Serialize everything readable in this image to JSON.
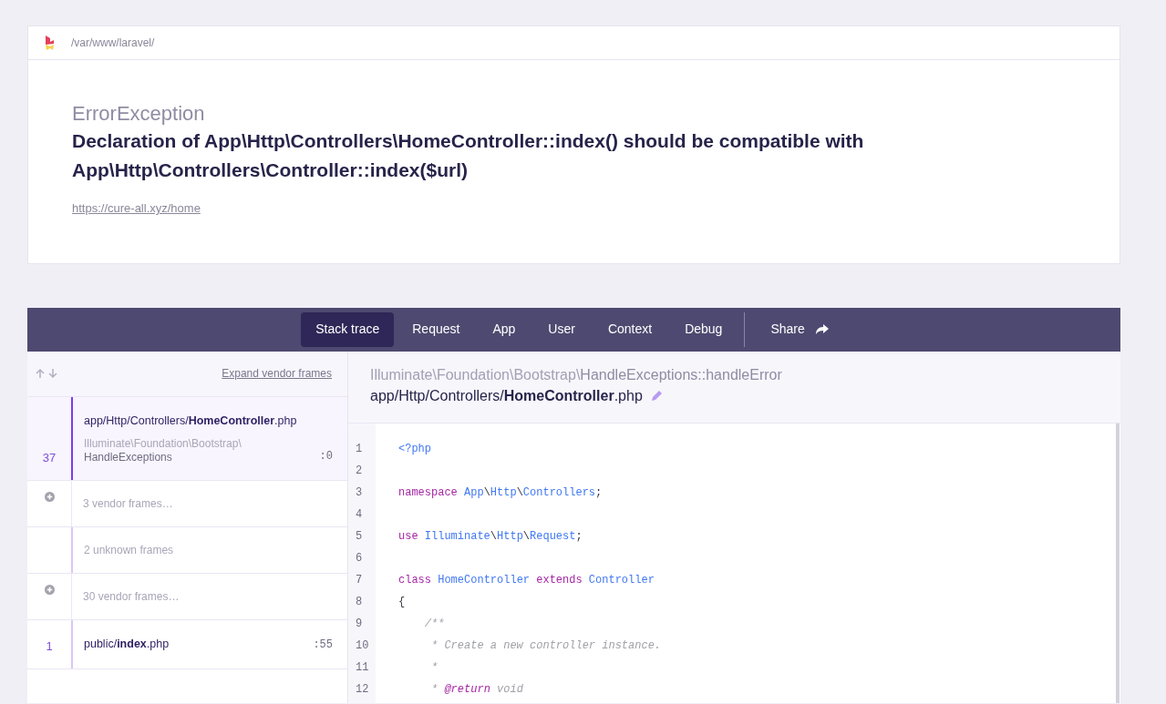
{
  "top": {
    "path": "/var/www/laravel/",
    "exception_class": "ErrorException",
    "message": "Declaration of App\\Http\\Controllers\\HomeController::index() should be compatible with App\\Http\\Controllers\\Controller::index($url)",
    "url": "https://cure-all.xyz/home"
  },
  "tabs": [
    {
      "label": "Stack trace",
      "selected": true
    },
    {
      "label": "Request",
      "selected": false
    },
    {
      "label": "App",
      "selected": false
    },
    {
      "label": "User",
      "selected": false
    },
    {
      "label": "Context",
      "selected": false
    },
    {
      "label": "Debug",
      "selected": false
    }
  ],
  "share": {
    "label": "Share"
  },
  "frames_header": {
    "expand_link": "Expand vendor frames"
  },
  "frames": [
    {
      "kind": "app",
      "selected": true,
      "number": "37",
      "file": "app/Http/Controllers/**HomeController**.php",
      "class_namespace": "Illuminate\\Foundation\\Bootstrap\\",
      "class_name": "HandleExceptions",
      "line": ":0"
    },
    {
      "kind": "vendor",
      "selected": false,
      "label": "3 vendor frames…"
    },
    {
      "kind": "unknown",
      "selected": false,
      "label": "2 unknown frames"
    },
    {
      "kind": "vendor",
      "selected": false,
      "label": "30 vendor frames…"
    },
    {
      "kind": "app",
      "selected": false,
      "number": "1",
      "file": "public/**index**.php",
      "line": ":55"
    }
  ],
  "source": {
    "namespace": "Illuminate\\Foundation\\Bootstrap\\",
    "method": "HandleExceptions::handleError",
    "file": "app/Http/Controllers/**HomeController**.php",
    "lines": [
      {
        "number": "1",
        "tokens": [
          {
            "t": "<?php",
            "kind": "tag"
          }
        ]
      },
      {
        "number": "2"
      },
      {
        "number": "3",
        "tokens": [
          {
            "t": "namespace ",
            "kind": "keyword"
          },
          {
            "t": "App",
            "kind": "class"
          },
          {
            "t": "\\",
            "kind": "plain"
          },
          {
            "t": "Http",
            "kind": "class"
          },
          {
            "t": "\\",
            "kind": "plain"
          },
          {
            "t": "Controllers",
            "kind": "class"
          },
          {
            "t": ";",
            "kind": "plain"
          }
        ]
      },
      {
        "number": "4"
      },
      {
        "number": "5",
        "tokens": [
          {
            "t": "use ",
            "kind": "keyword"
          },
          {
            "t": "Illuminate",
            "kind": "class"
          },
          {
            "t": "\\",
            "kind": "plain"
          },
          {
            "t": "Http",
            "kind": "class"
          },
          {
            "t": "\\",
            "kind": "plain"
          },
          {
            "t": "Request",
            "kind": "class"
          },
          {
            "t": ";",
            "kind": "plain"
          }
        ]
      },
      {
        "number": "6"
      },
      {
        "number": "7",
        "tokens": [
          {
            "t": "class ",
            "kind": "keyword"
          },
          {
            "t": "HomeController ",
            "kind": "class"
          },
          {
            "t": "extends ",
            "kind": "keyword"
          },
          {
            "t": "Controller",
            "kind": "class"
          }
        ]
      },
      {
        "number": "8",
        "tokens": [
          {
            "t": "{",
            "kind": "plain"
          }
        ]
      },
      {
        "number": "9",
        "tokens": [
          {
            "t": "    /**",
            "kind": "comment"
          }
        ]
      },
      {
        "number": "10",
        "tokens": [
          {
            "t": "     * Create a new controller instance.",
            "kind": "comment"
          }
        ]
      },
      {
        "number": "11",
        "tokens": [
          {
            "t": "     *",
            "kind": "comment"
          }
        ]
      },
      {
        "number": "12",
        "tokens": [
          {
            "t": "     * ",
            "kind": "comment"
          },
          {
            "t": "@return",
            "kind": "doctag"
          },
          {
            "t": " void",
            "kind": "comment"
          }
        ]
      }
    ]
  }
}
